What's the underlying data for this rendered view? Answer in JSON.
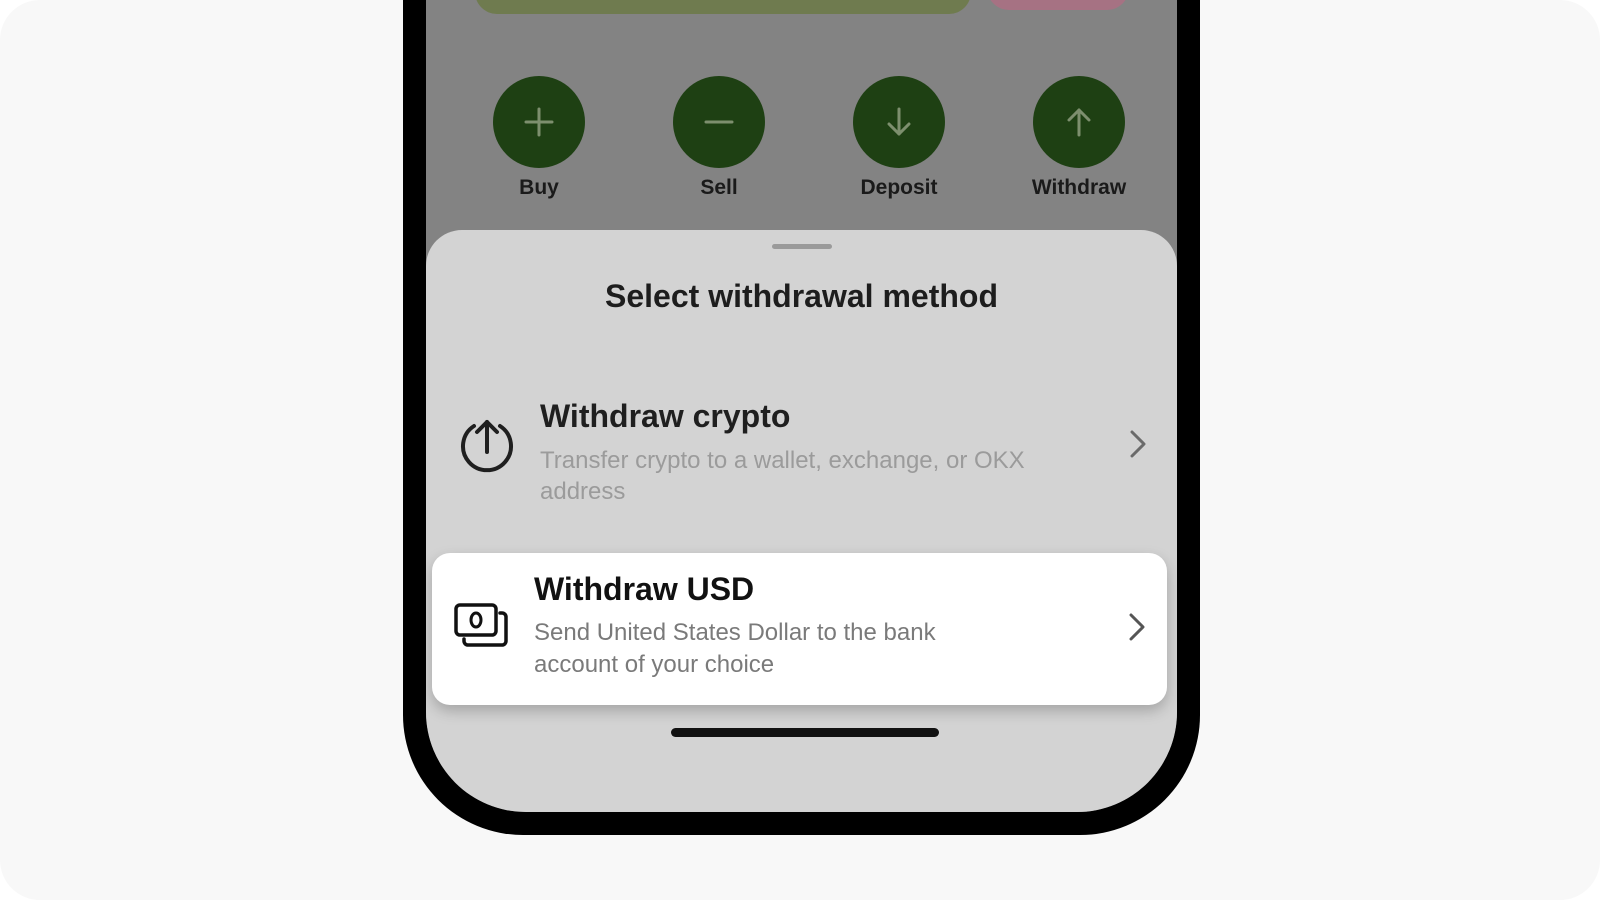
{
  "actions": [
    {
      "label": "Buy",
      "icon": "plus-icon"
    },
    {
      "label": "Sell",
      "icon": "minus-icon"
    },
    {
      "label": "Deposit",
      "icon": "arrow-down-icon"
    },
    {
      "label": "Withdraw",
      "icon": "arrow-up-icon"
    }
  ],
  "sheet": {
    "title": "Select withdrawal method",
    "options": [
      {
        "title": "Withdraw crypto",
        "description": "Transfer crypto to a wallet, exchange, or OKX address",
        "icon": "upload-circle-icon"
      },
      {
        "title": "Withdraw USD",
        "description": "Send United States Dollar to the bank account of your choice",
        "icon": "cash-stack-icon"
      }
    ]
  },
  "colors": {
    "action_circle": "#1e4013",
    "overlay": "#838383",
    "sheet": "#d3d3d3",
    "card": "#ffffff"
  }
}
